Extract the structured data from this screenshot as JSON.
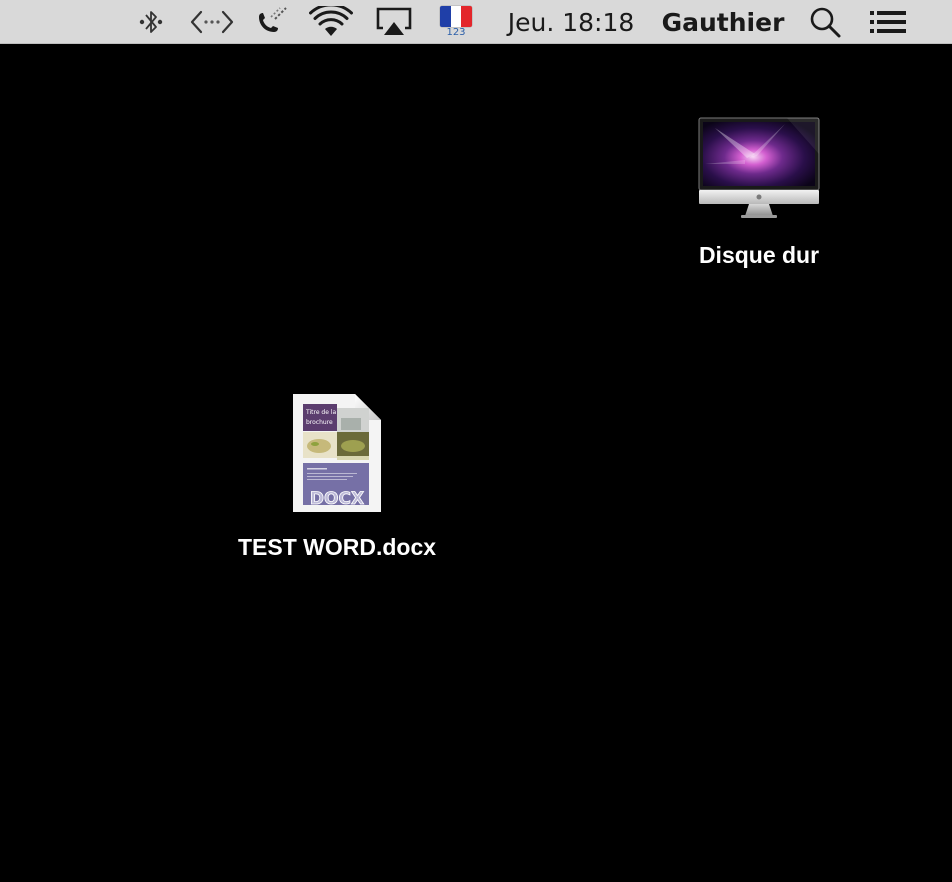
{
  "menubar": {
    "clock": "Jeu. 18:18",
    "user": "Gauthier",
    "input_source_sub": "123",
    "icons": [
      "bluetooth-icon",
      "vpn-icon",
      "phone-icon",
      "wifi-icon",
      "airplay-icon",
      "flag-icon",
      "search-icon",
      "menu-list-icon"
    ],
    "flag_colors": [
      "#1f3fa8",
      "#ffffff",
      "#e3262b"
    ]
  },
  "desktop": {
    "items": [
      {
        "label": "Disque dur",
        "icon": "hard-drive-imac-icon"
      },
      {
        "label": "TEST WORD.docx",
        "icon": "docx-file-icon"
      }
    ],
    "doc_preview": {
      "title_line1": "Titre de la",
      "title_line2": "brochure",
      "badge": "DOCX"
    }
  },
  "colors": {
    "background": "#000000",
    "menubar": "#d9d9d9",
    "doc_purple": "#5b3d6e",
    "doc_lavender": "#7670a6"
  }
}
